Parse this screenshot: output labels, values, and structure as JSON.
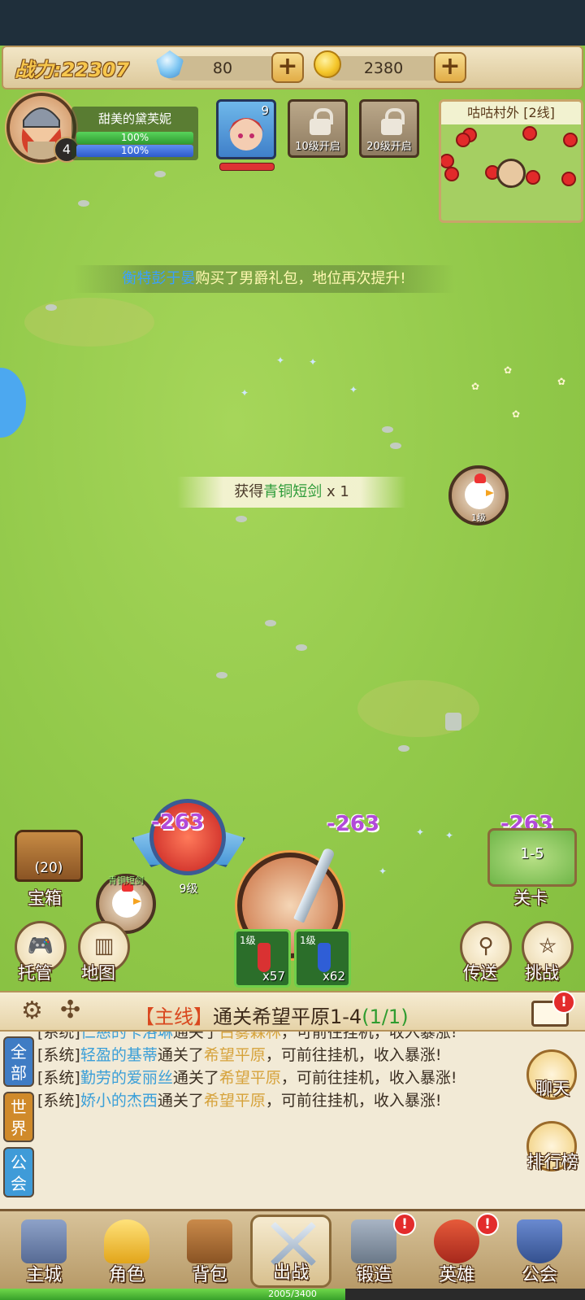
{
  "top_bar": {
    "power_label": "战力:22307",
    "gems": "80",
    "coins": "2380",
    "plus_symbol": "+"
  },
  "player": {
    "name": "甜美的黛芙妮",
    "level": "4",
    "hp_percent": "100%",
    "mp_percent": "100%"
  },
  "party": {
    "hero_level": "9",
    "locked_slots": [
      {
        "label": "10级开启"
      },
      {
        "label": "20级开启"
      }
    ]
  },
  "minimap": {
    "title": "咕咕村外 [2线]"
  },
  "announcement": {
    "name": "衡特彭于晏",
    "text": "购买了男爵礼包，地位再次提升!"
  },
  "loot_popup": {
    "prefix": "获得",
    "item": "青铜短剑",
    "suffix": " x 1"
  },
  "battle": {
    "damage_numbers": [
      "-263",
      "-263",
      "-263"
    ],
    "enemy_level": "1级",
    "left_enemy_label": "青铜短剑",
    "ally_level": "9级"
  },
  "potions": [
    {
      "level": "1级",
      "count": "x57",
      "color": "#d93232"
    },
    {
      "level": "1级",
      "count": "x62",
      "color": "#2f5ed6"
    }
  ],
  "side_buttons": {
    "chest_label": "宝箱",
    "chest_count": "(20)",
    "auto_label": "托管",
    "map_label": "地图",
    "stage_label": "关卡",
    "stage_value": "1-5",
    "teleport_label": "传送",
    "challenge_label": "挑战"
  },
  "quest": {
    "tag": "【主线】",
    "text": "通关希望平原1-4",
    "progress": "(1/1)",
    "mail_badge": "!"
  },
  "chat": {
    "tabs": [
      "全部",
      "世界",
      "公会"
    ],
    "lines": [
      {
        "prefix": "[系统]",
        "who": "仁慈的卡洛琳",
        "mid": "通关了",
        "where": "白雾森林",
        "rest": "，可前往挂机，收入暴涨!"
      },
      {
        "prefix": "[系统]",
        "who": "轻盈的基蒂",
        "mid": "通关了",
        "where": "希望平原",
        "rest": "，可前往挂机，收入暴涨!"
      },
      {
        "prefix": "[系统]",
        "who": "勤劳的爱丽丝",
        "mid": "通关了",
        "where": "希望平原",
        "rest": "，可前往挂机，收入暴涨!"
      },
      {
        "prefix": "[系统]",
        "who": "娇小的杰西",
        "mid": "通关了",
        "where": "希望平原",
        "rest": "，可前往挂机，收入暴涨!"
      }
    ],
    "chat_button": "聊天",
    "rank_button": "排行榜"
  },
  "nav": {
    "items": [
      {
        "label": "主城",
        "badge": ""
      },
      {
        "label": "角色",
        "badge": ""
      },
      {
        "label": "背包",
        "badge": ""
      },
      {
        "label": "出战",
        "badge": ""
      },
      {
        "label": "锻造",
        "badge": "!"
      },
      {
        "label": "英雄",
        "badge": "!"
      },
      {
        "label": "公会",
        "badge": ""
      }
    ]
  },
  "exp": {
    "text": "2005/3400",
    "fraction": 0.59
  },
  "colors": {
    "grass": "#92c94a",
    "damage": "#b24ad8",
    "badge_red": "#e32c2c"
  }
}
